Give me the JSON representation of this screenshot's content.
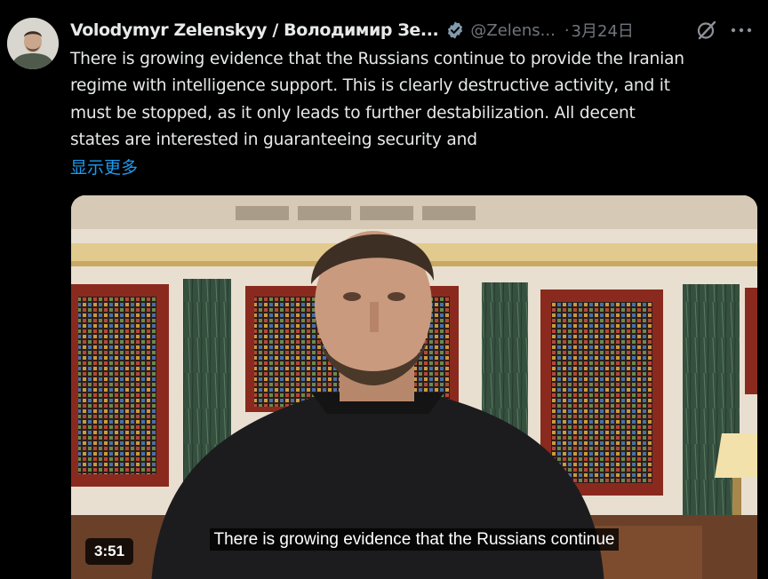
{
  "author": {
    "display_name": "Volodymyr Zelenskyy / Володимир Зе...",
    "handle": "@Zelens...",
    "verified": true
  },
  "tweet": {
    "separator": "·",
    "date": "3月24日",
    "text_lines": [
      "There is growing evidence that the Russians continue to provide the Iranian",
      "regime with intelligence support. This is clearly destructive activity, and it",
      "must be stopped, as it only leads to further destabilization. All decent",
      "states are interested in guaranteeing security and"
    ],
    "show_more": "显示更多"
  },
  "video": {
    "subtitle": "There is growing evidence that the Russians continue",
    "duration": "3:51"
  },
  "icons": {
    "verified": "verified-badge-icon",
    "grok": "grok-icon",
    "more": "more-icon"
  },
  "colors": {
    "background": "#000000",
    "text": "#e7e9ea",
    "secondary": "#71767b",
    "link": "#1d9bf0",
    "verified_badge": "#829aab"
  }
}
